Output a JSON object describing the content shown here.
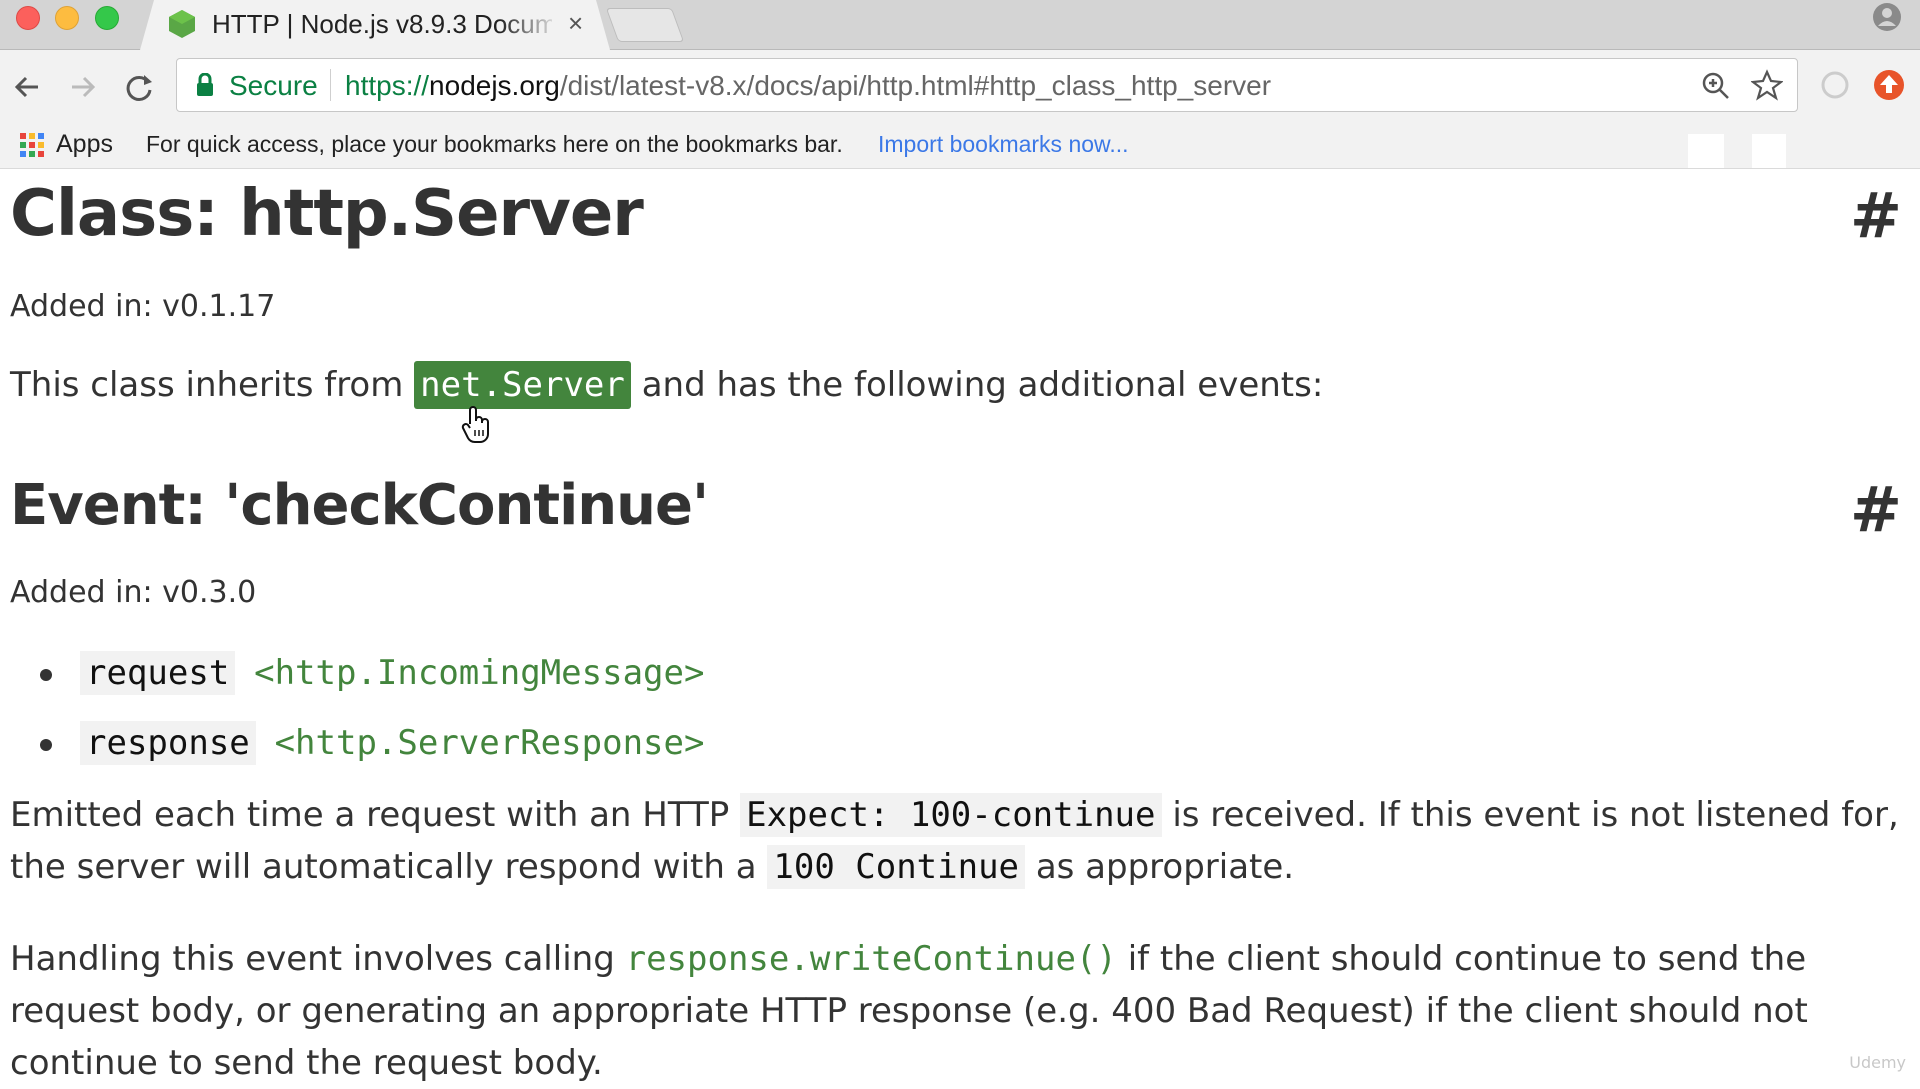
{
  "browser": {
    "tab": {
      "title": "HTTP | Node.js v8.9.3 Docume",
      "close": "×",
      "favicon": "nodejs-hexagon-icon"
    },
    "toolbar": {
      "back_icon": "back-arrow-icon",
      "forward_icon": "forward-arrow-icon",
      "reload_icon": "reload-icon",
      "secure_label": "Secure",
      "url": {
        "scheme": "https://",
        "host": "nodejs.org",
        "path": "/dist/latest-v8.x/docs/api/http.html#http_class_http_server"
      }
    },
    "bookmarks": {
      "apps_label": "Apps",
      "hint": "For quick access, place your bookmarks here on the bookmarks bar.",
      "import_link": "Import bookmarks now..."
    }
  },
  "page": {
    "class_heading": "Class: http.Server",
    "hash": "#",
    "class_added": "Added in: v0.1.17",
    "inherits": {
      "prefix": "This class inherits from",
      "link": "net.Server",
      "suffix": "and has the following additional events:"
    },
    "event_heading": "Event: 'checkContinue'",
    "event_added": "Added in: v0.3.0",
    "params": [
      {
        "name": "request",
        "type": "<http.IncomingMessage>"
      },
      {
        "name": "response",
        "type": "<http.ServerResponse>"
      }
    ],
    "emit_para": {
      "t1": "Emitted each time a request with an HTTP",
      "code1": "Expect: 100-continue",
      "t2": "is received. If this event is not listened for, the server will automatically respond with a",
      "code2": "100 Continue",
      "t3": "as appropriate."
    },
    "handle_para": {
      "t1": "Handling this event involves calling",
      "code": "response.writeContinue()",
      "t2": "if the client should continue to send the request body, or generating an appropriate HTTP response (e.g. 400 Bad Request) if the client should not continue to send the request body."
    },
    "watermark": "Udemy"
  },
  "colors": {
    "node_green": "#43853d",
    "secure_green": "#0b8043",
    "link_blue": "#3b78e7"
  }
}
